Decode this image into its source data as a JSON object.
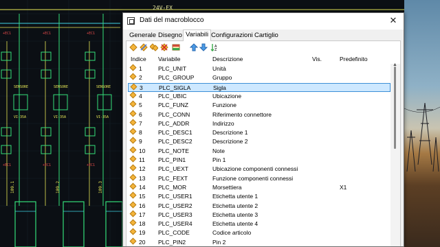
{
  "dialog": {
    "title": "Dati del macroblocco",
    "close_glyph": "✕"
  },
  "tabs": [
    "Generale",
    "Disegno",
    "Variabili",
    "Configurazioni",
    "Cartiglio"
  ],
  "active_tab": "Variabili",
  "columns": {
    "index": "Indice",
    "variable": "Variabile",
    "description": "Descrizione",
    "vis": "Vis.",
    "default": "Predefinito"
  },
  "rows": [
    {
      "i": "1",
      "var": "PLC_UNIT",
      "desc": "Unità",
      "def": ""
    },
    {
      "i": "2",
      "var": "PLC_GROUP",
      "desc": "Gruppo",
      "def": ""
    },
    {
      "i": "3",
      "var": "PLC_SIGLA",
      "desc": "Sigla",
      "def": ""
    },
    {
      "i": "4",
      "var": "PLC_UBIC",
      "desc": "Ubicazione",
      "def": ""
    },
    {
      "i": "5",
      "var": "PLC_FUNZ",
      "desc": "Funzione",
      "def": ""
    },
    {
      "i": "6",
      "var": "PLC_CONN",
      "desc": "Riferimento connettore",
      "def": ""
    },
    {
      "i": "7",
      "var": "PLC_ADDR",
      "desc": "Indirizzo",
      "def": ""
    },
    {
      "i": "8",
      "var": "PLC_DESC1",
      "desc": "Descrizione 1",
      "def": ""
    },
    {
      "i": "9",
      "var": "PLC_DESC2",
      "desc": "Descrizione 2",
      "def": ""
    },
    {
      "i": "10",
      "var": "PLC_NOTE",
      "desc": "Note",
      "def": ""
    },
    {
      "i": "11",
      "var": "PLC_PIN1",
      "desc": "Pin 1",
      "def": ""
    },
    {
      "i": "12",
      "var": "PLC_UEXT",
      "desc": "Ubicazione componenti connessi",
      "def": ""
    },
    {
      "i": "13",
      "var": "PLC_FEXT",
      "desc": "Funzione componenti connessi",
      "def": ""
    },
    {
      "i": "14",
      "var": "PLC_MOR",
      "desc": "Morsettiera",
      "def": "X1"
    },
    {
      "i": "15",
      "var": "PLC_USER1",
      "desc": "Etichetta utente 1",
      "def": ""
    },
    {
      "i": "16",
      "var": "PLC_USER2",
      "desc": "Etichetta utente 2",
      "def": ""
    },
    {
      "i": "17",
      "var": "PLC_USER3",
      "desc": "Etichetta utente 3",
      "def": ""
    },
    {
      "i": "18",
      "var": "PLC_USER4",
      "desc": "Etichetta utente 4",
      "def": ""
    },
    {
      "i": "19",
      "var": "PLC_CODE",
      "desc": "Codice articolo",
      "def": ""
    },
    {
      "i": "20",
      "var": "PLC_PIN2",
      "desc": "Pin 2",
      "def": ""
    }
  ],
  "selected_row": 3,
  "toolbar_icons": [
    "add-variable-icon",
    "edit-variable-icon",
    "copy-variable-icon",
    "delete-variable-icon",
    "table-icon",
    "move-up-icon",
    "move-down-icon",
    "sort-icon"
  ],
  "cad": {
    "supply_label": "24V-EX",
    "module_labels": [
      "109.1",
      "109.2",
      "109.3"
    ]
  },
  "colors": {
    "selection_bg": "#cde8ff",
    "selection_border": "#3c8fd6",
    "diamond": "#f4b43a",
    "cad_bg": "#0b0f14",
    "cad_green": "#34e07a",
    "cad_yellow": "#e8e857",
    "cad_cyan": "#41d6e6"
  }
}
